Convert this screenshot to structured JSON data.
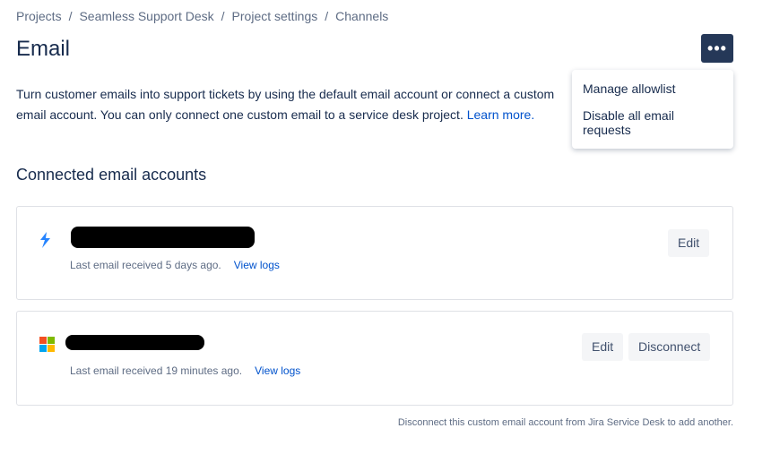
{
  "breadcrumbs": [
    "Projects",
    "Seamless Support Desk",
    "Project settings",
    "Channels"
  ],
  "title": "Email",
  "more_label": "•••",
  "description": "Turn customer emails into support tickets by using the default email account or connect a custom email account. You can only connect one custom email to a service desk project.",
  "learn_more": "Learn more.",
  "menu": [
    "Manage allowlist",
    "Disable all email requests"
  ],
  "section_title": "Connected email accounts",
  "accounts": [
    {
      "icon": "jira-bolt-icon",
      "last": "Last email received 5 days ago.",
      "logs": "View logs",
      "edit": "Edit"
    },
    {
      "icon": "microsoft-icon",
      "last": "Last email received 19 minutes ago.",
      "logs": "View logs",
      "edit": "Edit",
      "disconnect": "Disconnect"
    }
  ],
  "footer": "Disconnect this custom email account from Jira Service Desk to add another."
}
